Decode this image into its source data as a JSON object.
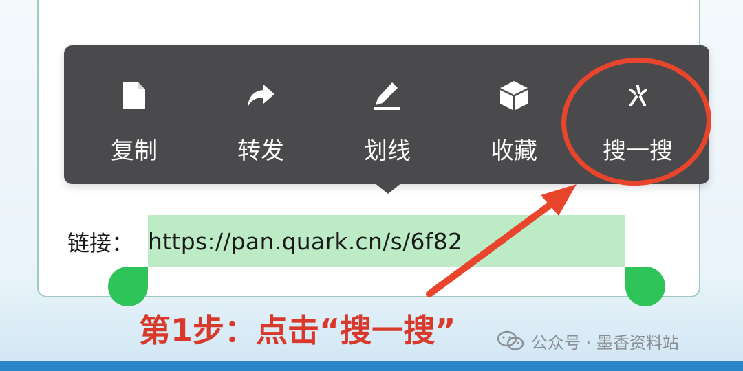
{
  "selection": {
    "label": "链接：",
    "url": "https://pan.quark.cn/s/6f82"
  },
  "context_menu": {
    "items": [
      {
        "label": "复制",
        "icon": "document-copy-icon"
      },
      {
        "label": "转发",
        "icon": "share-forward-icon"
      },
      {
        "label": "划线",
        "icon": "pen-underline-icon"
      },
      {
        "label": "收藏",
        "icon": "box-favorite-icon"
      },
      {
        "label": "搜一搜",
        "icon": "sparkle-search-icon"
      }
    ]
  },
  "instruction": {
    "text": "第1步：点击“搜一搜”"
  },
  "watermark": {
    "text": "公众号 · 墨香资料站",
    "icon": "wechat-icon"
  },
  "colors": {
    "menu_bg": "#4a4a4c",
    "highlight": "#bdebc6",
    "handle": "#2ec45a",
    "annotation_red": "#e8452c",
    "instruction_red": "#d8392b"
  }
}
